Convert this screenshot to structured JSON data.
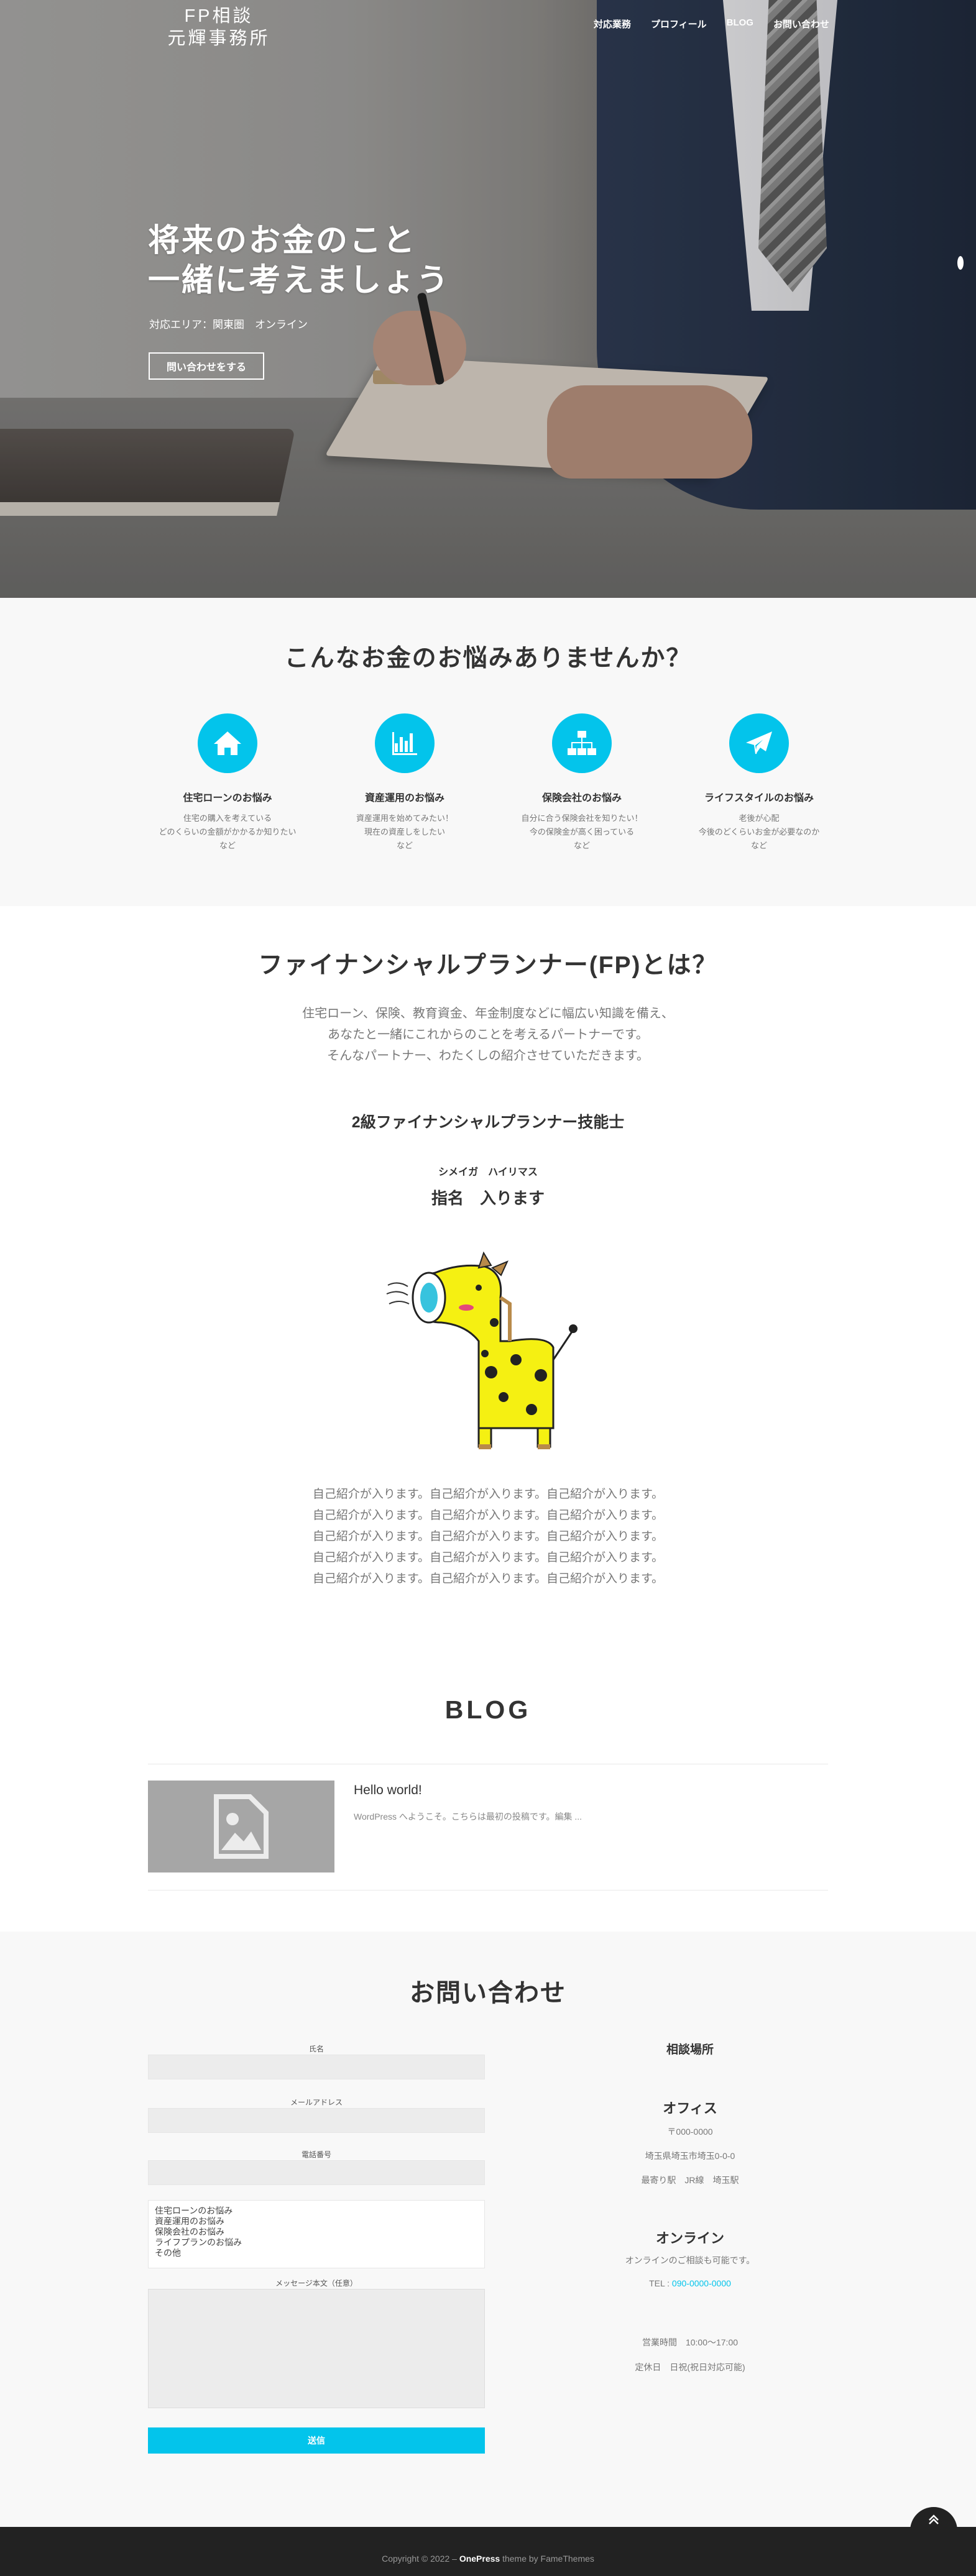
{
  "header": {
    "logo_line1": "FP相談",
    "logo_line2": "元輝事務所",
    "nav": [
      "対応業務",
      "プロフィール",
      "BLOG",
      "お問い合わせ"
    ]
  },
  "hero": {
    "title_line1": "将来のお金のこと",
    "title_line2": "一緒に考えましょう",
    "subtitle": "対応エリア：関東圏　オンライン",
    "button": "問い合わせをする"
  },
  "worries": {
    "title": "こんなお金のお悩みありませんか？",
    "items": [
      {
        "icon": "home-icon",
        "title": "住宅ローンのお悩み",
        "text": [
          "住宅の購入を考えている",
          "どのくらいの金額がかかるか知りたい",
          "など"
        ]
      },
      {
        "icon": "bar-chart-icon",
        "title": "資産運用のお悩み",
        "text": [
          "資産運用を始めてみたい！",
          "現在の資産しをしたい",
          "など"
        ]
      },
      {
        "icon": "sitemap-icon",
        "title": "保険会社のお悩み",
        "text": [
          "自分に合う保険会社を知りたい！",
          "今の保険金が高く困っている",
          "など"
        ]
      },
      {
        "icon": "paper-plane-icon",
        "title": "ライフスタイルのお悩み",
        "text": [
          "老後が心配",
          "今後のどくらいお金が必要なのか",
          "など"
        ]
      }
    ]
  },
  "fp": {
    "title": "ファイナンシャルプランナー(FP)とは？",
    "lead": [
      "住宅ローン、保険、教育資金、年金制度などに幅広い知識を備え、",
      "あなたと一緒にこれからのことを考えるパートナーです。",
      "そんなパートナー、わたくしの紹介させていただきます。"
    ],
    "qualification": "2級ファイナンシャルプランナー技能士",
    "reading": "シメイガ　ハイリマス",
    "name": "指名　入ります",
    "bio": [
      "自己紹介が入ります。自己紹介が入ります。自己紹介が入ります。",
      "自己紹介が入ります。自己紹介が入ります。自己紹介が入ります。",
      "自己紹介が入ります。自己紹介が入ります。自己紹介が入ります。",
      "自己紹介が入ります。自己紹介が入ります。自己紹介が入ります。",
      "自己紹介が入ります。自己紹介が入ります。自己紹介が入ります。"
    ]
  },
  "blog": {
    "title": "BLOG",
    "post_title": "Hello world!",
    "post_excerpt": "WordPress へようこそ。こちらは最初の投稿です。編集 ..."
  },
  "contact": {
    "title": "お問い合わせ",
    "labels": {
      "name": "氏名",
      "email": "メールアドレス",
      "phone": "電話番号",
      "message": "メッセージ本文（任意）"
    },
    "options": [
      "住宅ローンのお悩み",
      "資産運用のお悩み",
      "保険会社のお悩み",
      "ライフプランのお悩み",
      "その他"
    ],
    "submit": "送信",
    "place_heading": "相談場所",
    "office_heading": "オフィス",
    "postal": "〒000-0000",
    "address": "埼玉県埼玉市埼玉0-0-0",
    "station": "最寄り駅　JR線　埼玉駅",
    "online_heading": "オンライン",
    "online_text": "オンラインのご相談も可能です。",
    "tel_label": "TEL : ",
    "tel": "090-0000-0000",
    "hours": "営業時間　10:00〜17:00",
    "holiday": "定休日　日祝(祝日対応可能)"
  },
  "footer": {
    "copy": "Copyright © 2022 – ",
    "brand": "OnePress",
    "suffix": " theme by FameThemes"
  },
  "colors": {
    "accent": "#03c4eb",
    "footer": "#222222"
  }
}
